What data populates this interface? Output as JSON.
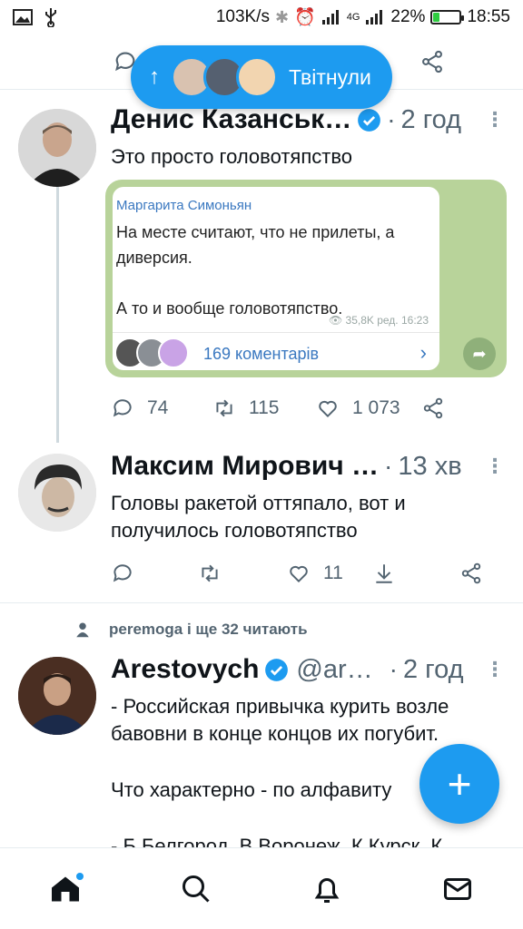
{
  "status_bar": {
    "speed": "103K/s",
    "network": "4G",
    "battery": "22%",
    "battery_level": 0.22,
    "time": "18:55"
  },
  "new_tweets_pill": {
    "label": "Твітнули"
  },
  "tweets": [
    {
      "name": "Денис Казанськ…",
      "verified": true,
      "time": "2 год",
      "text": "Это просто головотяпство",
      "card": {
        "author": "Маргарита Симоньян",
        "text": "На месте считают, что не прилеты, а диверсия.\n\nА то и вообще головотяпство.",
        "meta": "👁 35,8K ред. 16:23",
        "comments": "169 коментарів"
      },
      "replies": "74",
      "retweets": "115",
      "likes": "1 073"
    },
    {
      "name": "Максим Мирович …",
      "time": "13 хв",
      "text": "Головы ракетой оттяпало, вот и получилось головотяпство",
      "likes": "11"
    },
    {
      "retweeted_by": "peremoga і ще 32 читають",
      "name": "Arestovych",
      "verified": true,
      "handle": "@ar…",
      "time": "2 год",
      "text_lines": [
        "- Российская привычка курить возле бавовни в конце концов их погубит.",
        "Что характерно - по алфавиту",
        "- Б Белгород, В Воронеж, К Курск, К"
      ]
    }
  ],
  "colors": {
    "accent": "#1d9bf0",
    "muted_text": "#536471",
    "divider": "#e6ecf0"
  }
}
